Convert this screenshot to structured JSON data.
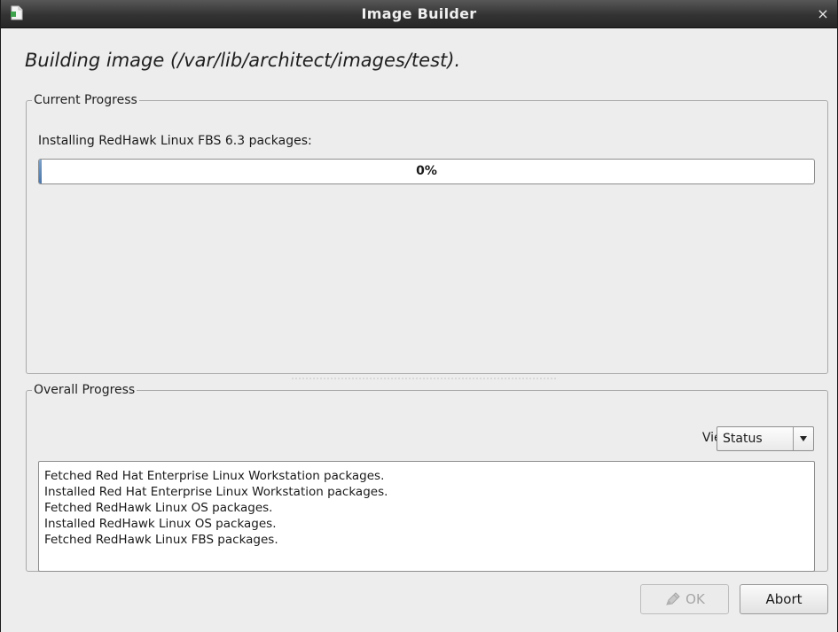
{
  "window": {
    "title": "Image Builder",
    "close_glyph": "×",
    "app_icon": "document-icon"
  },
  "heading": "Building image (/var/lib/architect/images/test).",
  "current_progress": {
    "legend": "Current Progress",
    "task": "Installing RedHawk Linux FBS 6.3 packages:",
    "percent_text": "0%",
    "progress_fraction": 0
  },
  "overall_progress": {
    "legend": "Overall Progress",
    "view_label": "View:",
    "view_selected": "Status",
    "log_lines": [
      "Fetched Red Hat Enterprise Linux Workstation packages.",
      "Installed Red Hat Enterprise Linux Workstation packages.",
      "Fetched RedHawk Linux OS packages.",
      "Installed RedHawk Linux OS packages.",
      "Fetched RedHawk Linux FBS packages."
    ]
  },
  "buttons": {
    "ok_label": "OK",
    "ok_icon": "pencil-icon",
    "ok_enabled": false,
    "abort_label": "Abort"
  },
  "colors": {
    "titlebar": "#333333",
    "progress_fill": "#5a84b5"
  }
}
